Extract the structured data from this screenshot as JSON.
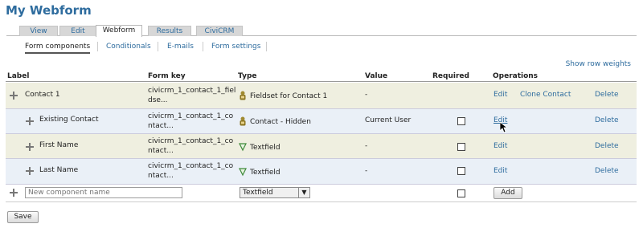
{
  "page_title": "My Webform",
  "tabs": [
    "View",
    "Edit",
    "Webform",
    "Results",
    "CiviCRM"
  ],
  "subtabs": [
    "Form components",
    "Conditionals",
    "E-mails",
    "Form settings"
  ],
  "show_row_weights": "Show row weights",
  "columns": {
    "label": "Label",
    "form_key": "Form key",
    "type": "Type",
    "value": "Value",
    "required": "Required",
    "operations": "Operations"
  },
  "rows": [
    {
      "label": "Contact 1",
      "key1": "civicrm_1_contact_1_fiel",
      "key2": "dse...",
      "type": "Fieldset for Contact 1",
      "type_icon": "fieldset-icon",
      "value": "-",
      "required": false,
      "op_edit": "Edit",
      "op_clone": "Clone Contact",
      "op_delete": "Delete"
    },
    {
      "label": "Existing Contact",
      "key1": "civicrm_1_contact_1_co",
      "key2": "ntact...",
      "type": "Contact - Hidden",
      "type_icon": "contact-icon",
      "value": "Current User",
      "required": false,
      "op_edit": "Edit",
      "op_delete": "Delete"
    },
    {
      "label": "First Name",
      "key1": "civicrm_1_contact_1_co",
      "key2": "ntact...",
      "type": "Textfield",
      "type_icon": "textfield-icon",
      "value": "-",
      "required": false,
      "op_edit": "Edit",
      "op_delete": "Delete"
    },
    {
      "label": "Last Name",
      "key1": "civicrm_1_contact_1_co",
      "key2": "ntact...",
      "type": "Textfield",
      "type_icon": "textfield-icon",
      "value": "-",
      "required": false,
      "op_edit": "Edit",
      "op_delete": "Delete"
    }
  ],
  "new_component": {
    "placeholder": "New component name",
    "type_selected": "Textfield",
    "add_label": "Add"
  },
  "save_label": "Save",
  "colors": {
    "link": "#2e6c9e",
    "row_odd": "#efefe0",
    "row_even": "#eaf0f7"
  }
}
